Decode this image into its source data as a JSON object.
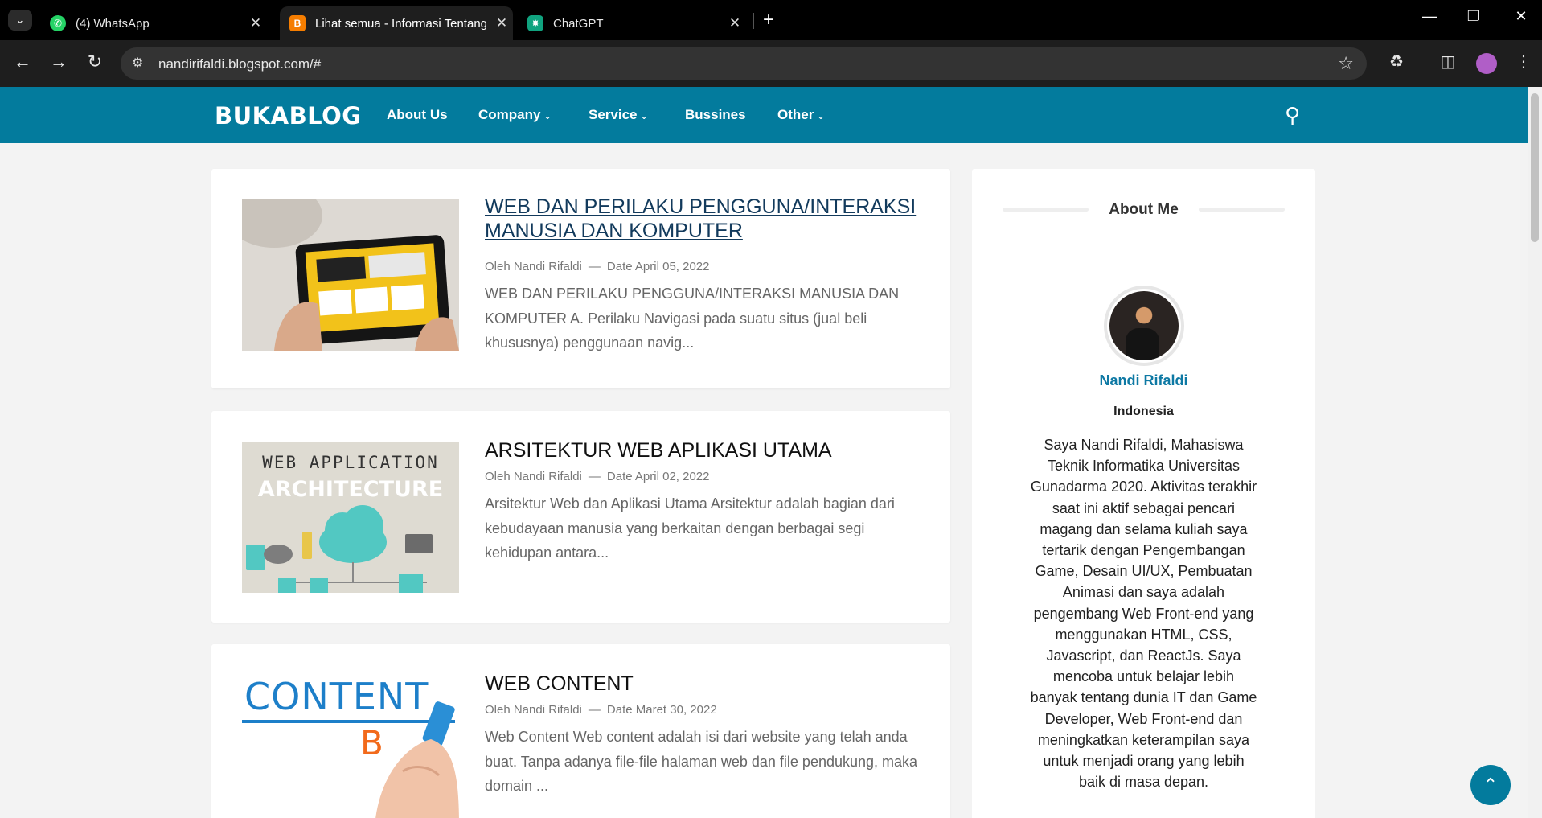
{
  "browser": {
    "tabs": [
      {
        "title": "(4) WhatsApp",
        "favicon": "whatsapp-icon",
        "color": "#25d366"
      },
      {
        "title": "Lihat semua - Informasi Tentang",
        "favicon": "blogger-icon",
        "color": "#f57d00",
        "active": true
      },
      {
        "title": "ChatGPT",
        "favicon": "chatgpt-icon",
        "color": "#10a37f"
      }
    ],
    "url": "nandirifaldi.blogspot.com/#"
  },
  "header": {
    "logo": "BUKABLOG",
    "menu": [
      {
        "label": "About Us",
        "dropdown": false
      },
      {
        "label": "Company",
        "dropdown": true
      },
      {
        "label": "Service",
        "dropdown": true
      },
      {
        "label": "Bussines",
        "dropdown": false
      },
      {
        "label": "Other",
        "dropdown": true
      }
    ],
    "accent_color": "#037b9d"
  },
  "posts": [
    {
      "title": "WEB DAN PERILAKU PENGGUNA/INTERAKSI MANUSIA DAN KOMPUTER",
      "author": "Oleh Nandi Rifaldi",
      "date": "Date April 05, 2022",
      "excerpt": "WEB DAN PERILAKU PENGGUNA/INTERAKSI MANUSIA DAN KOMPUTER       A. Perilaku Navigasi pada suatu situs (jual beli khususnya) penggunaan navig..."
    },
    {
      "title": "ARSITEKTUR WEB APLIKASI UTAMA",
      "author": "Oleh Nandi Rifaldi",
      "date": "Date April 02, 2022",
      "excerpt": "Arsitektur Web dan Aplikasi Utama   Arsitektur adalah bagian dari kebudayaan manusia yang berkaitan dengan berbagai segi kehidupan antara...",
      "thumb_line1": "WEB APPLICATION",
      "thumb_line2": "ARCHITECTURE"
    },
    {
      "title": "WEB CONTENT",
      "author": "Oleh Nandi Rifaldi",
      "date": "Date Maret 30, 2022",
      "excerpt": "Web Content Web content adalah isi dari website yang telah anda buat. Tanpa adanya file-file halaman web dan file pendukung, maka domain ...",
      "thumb_word": "CONTENT",
      "thumb_letter": "B"
    }
  ],
  "sidebar": {
    "widget_title": "About Me",
    "name": "Nandi Rifaldi",
    "location": "Indonesia",
    "bio": "Saya Nandi Rifaldi, Mahasiswa Teknik Informatika Universitas Gunadarma 2020. Aktivitas terakhir saat ini aktif sebagai pencari magang dan selama kuliah saya tertarik dengan Pengembangan Game, Desain UI/UX, Pembuatan Animasi dan saya adalah pengembang Web Front-end yang menggunakan HTML, CSS, Javascript, dan ReactJs. Saya mencoba untuk belajar lebih banyak tentang dunia IT dan Game Developer, Web Front-end dan meningkatkan keterampilan saya untuk menjadi orang yang lebih baik di masa depan."
  }
}
